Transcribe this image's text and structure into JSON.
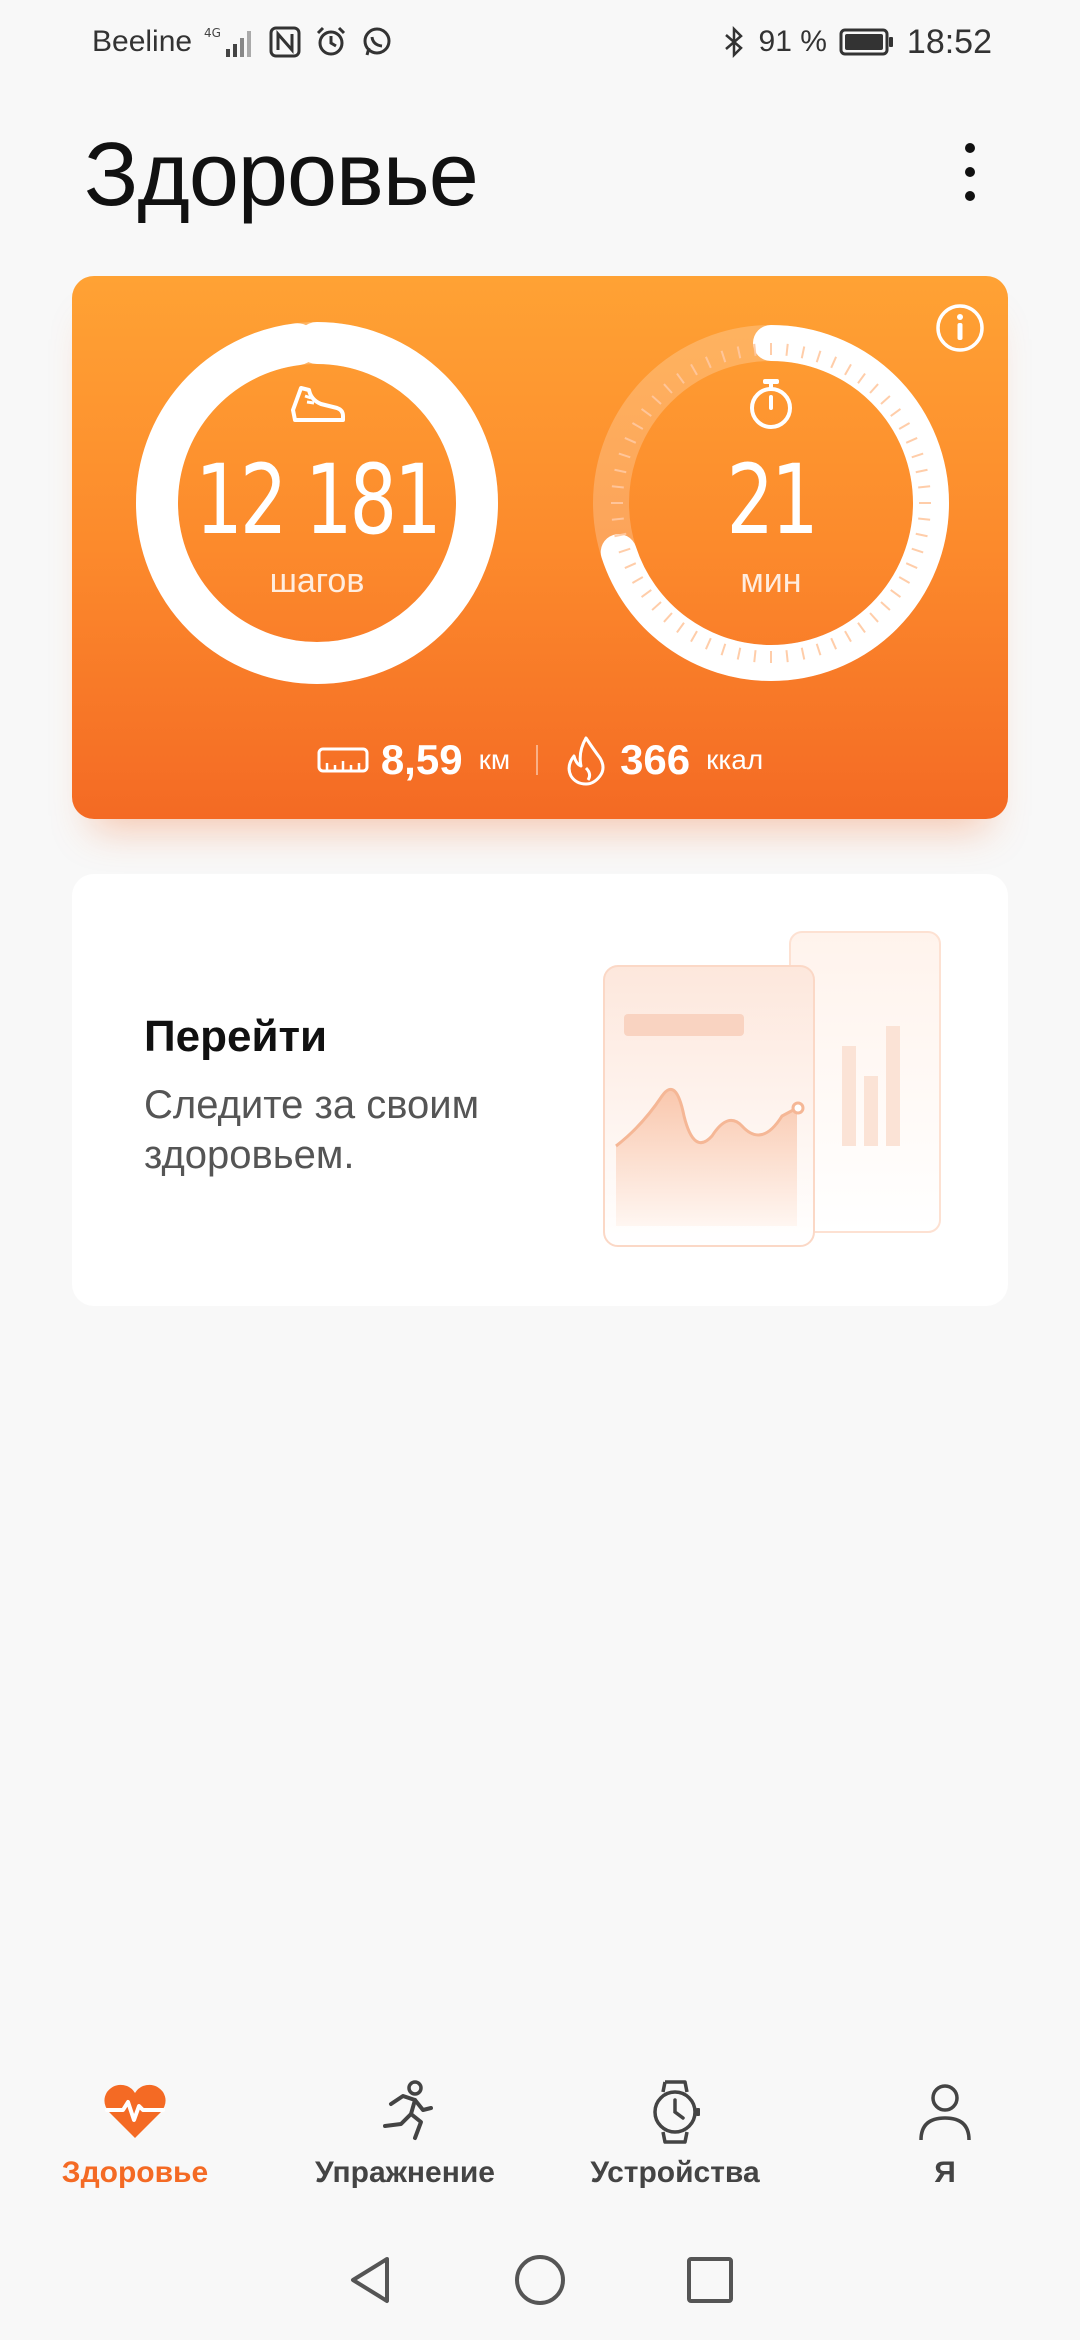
{
  "status_bar": {
    "carrier": "Beeline",
    "network": "4G",
    "battery": "91 %",
    "time": "18:52"
  },
  "header": {
    "title": "Здоровье"
  },
  "activity": {
    "steps": "12 181",
    "steps_unit": "шагов",
    "steps_progress": 0.98,
    "minutes": "21",
    "minutes_unit": "мин",
    "minutes_progress": 0.7,
    "distance_value": "8,59",
    "distance_unit": "км",
    "calories_value": "366",
    "calories_unit": "ккал"
  },
  "promo": {
    "title": "Перейти",
    "description": "Следите за своим здоровьем."
  },
  "bottom_nav": {
    "items": [
      {
        "label": "Здоровье",
        "icon": "heart-pulse-icon",
        "active": true
      },
      {
        "label": "Упражнение",
        "icon": "running-icon",
        "active": false
      },
      {
        "label": "Устройства",
        "icon": "watch-icon",
        "active": false
      },
      {
        "label": "Я",
        "icon": "person-icon",
        "active": false
      }
    ]
  },
  "colors": {
    "accent": "#f46a24",
    "card_top": "#ffa234",
    "card_bottom": "#f46a24",
    "background": "#f8f8f8"
  }
}
